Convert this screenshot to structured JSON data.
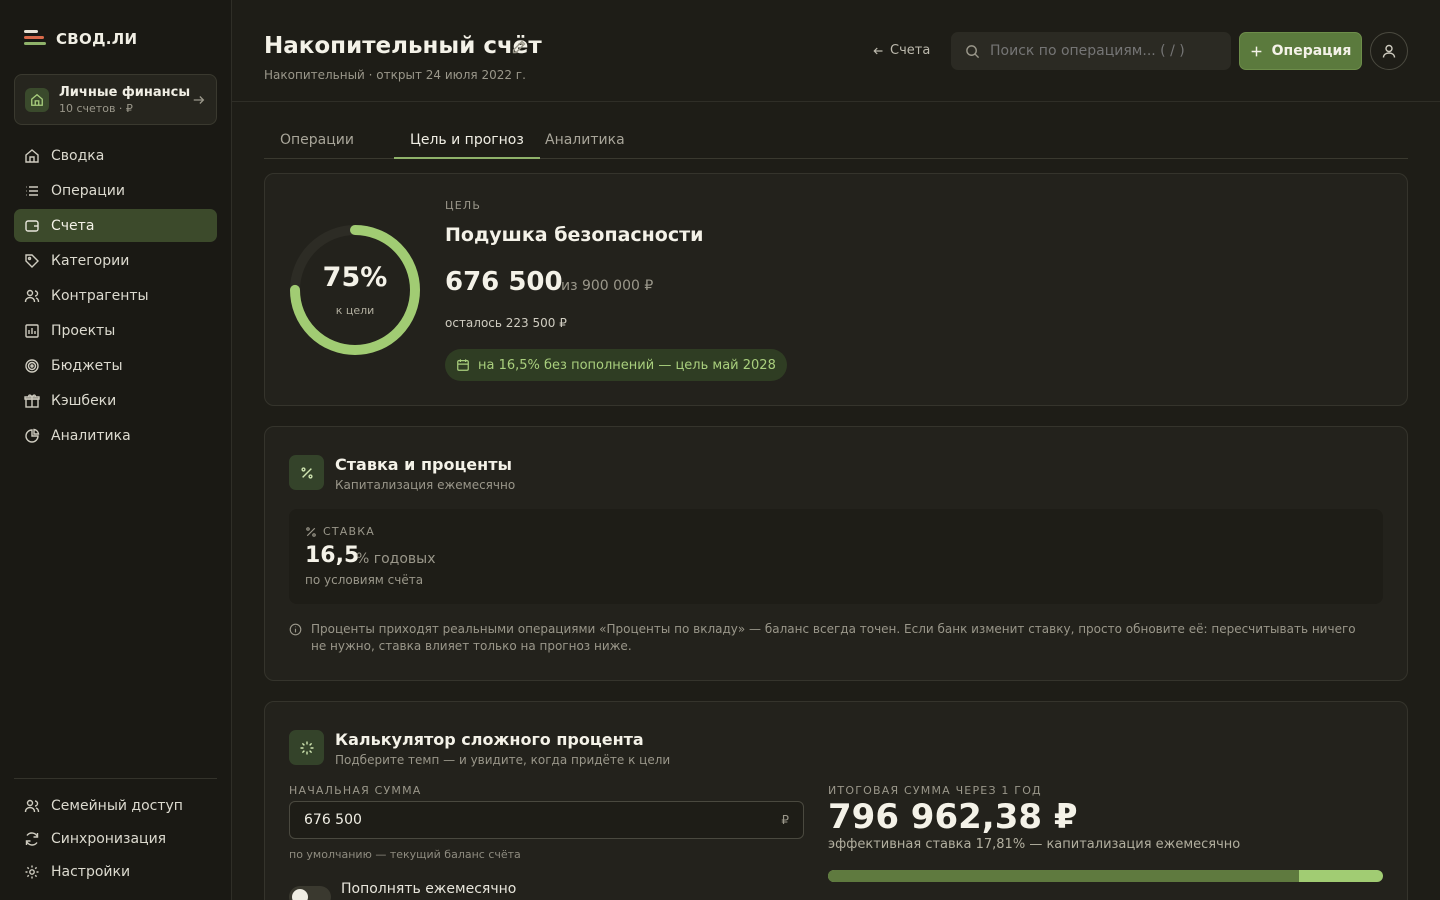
{
  "app": {
    "name": "СВОД.ЛИ"
  },
  "workspace": {
    "name": "Личные финансы",
    "meta": "10 счетов · ₽"
  },
  "sidebar": {
    "items": [
      {
        "label": "Сводка",
        "icon": "home-icon"
      },
      {
        "label": "Операции",
        "icon": "list-icon"
      },
      {
        "label": "Счета",
        "icon": "wallet-icon",
        "active": true
      },
      {
        "label": "Категории",
        "icon": "tag-icon"
      },
      {
        "label": "Контрагенты",
        "icon": "users-icon"
      },
      {
        "label": "Проекты",
        "icon": "chart-icon"
      },
      {
        "label": "Бюджеты",
        "icon": "target-icon"
      },
      {
        "label": "Кэшбеки",
        "icon": "gift-icon"
      },
      {
        "label": "Аналитика",
        "icon": "pie-icon"
      }
    ],
    "bottom": [
      {
        "label": "Семейный доступ",
        "icon": "family-icon"
      },
      {
        "label": "Синхронизация",
        "icon": "sync-icon"
      },
      {
        "label": "Настройки",
        "icon": "settings-icon"
      }
    ]
  },
  "header": {
    "title": "Накопительный счёт",
    "subtitle": "Накопительный · открыт 24 июля 2022 г.",
    "back_label": "Счета",
    "search_placeholder": "Поиск по операциям... ( / )",
    "operation_button": "Операция"
  },
  "tabs": [
    {
      "label": "Операции"
    },
    {
      "label": "Цель и прогноз",
      "active": true
    },
    {
      "label": "Аналитика"
    }
  ],
  "goal": {
    "progress_percent": 75,
    "progress_label": "75%",
    "progress_sub": "к цели",
    "section_label": "ЦЕЛЬ",
    "name": "Подушка безопасности",
    "current": "676 500",
    "of_total": "из 900 000 ₽",
    "remaining": "осталось 223 500 ₽",
    "forecast": "на 16,5% без пополнений — цель май 2028"
  },
  "rate": {
    "title": "Ставка и проценты",
    "subtitle": "Капитализация ежемесячно",
    "label": "СТАВКА",
    "value": "16,5",
    "unit": "% годовых",
    "condition": "по условиям счёта",
    "note": "Проценты приходят реальными операциями «Проценты по вкладу» — баланс всегда точен. Если банк изменит ставку, просто обновите её: пересчитывать ничего не нужно, ставка влияет только на прогноз ниже."
  },
  "calculator": {
    "title": "Калькулятор сложного процента",
    "subtitle": "Подберите темп — и увидите, когда придёте к цели",
    "initial_label": "НАЧАЛЬНАЯ СУММА",
    "initial_value": "676 500",
    "currency": "₽",
    "initial_hint": "по умолчанию — текущий баланс счёта",
    "toggle_label": "Пополнять ежемесячно",
    "result_label": "ИТОГОВАЯ СУММА ЧЕРЕЗ 1 ГОД",
    "result_value": "796 962,38 ₽",
    "result_sub": "эффективная ставка 17,81% — капитализация ежемесячно",
    "principal_share": 0.849
  },
  "colors": {
    "accent": "#5b7a3d",
    "accent_light": "#a1cc73",
    "background": "#1e1d17"
  }
}
